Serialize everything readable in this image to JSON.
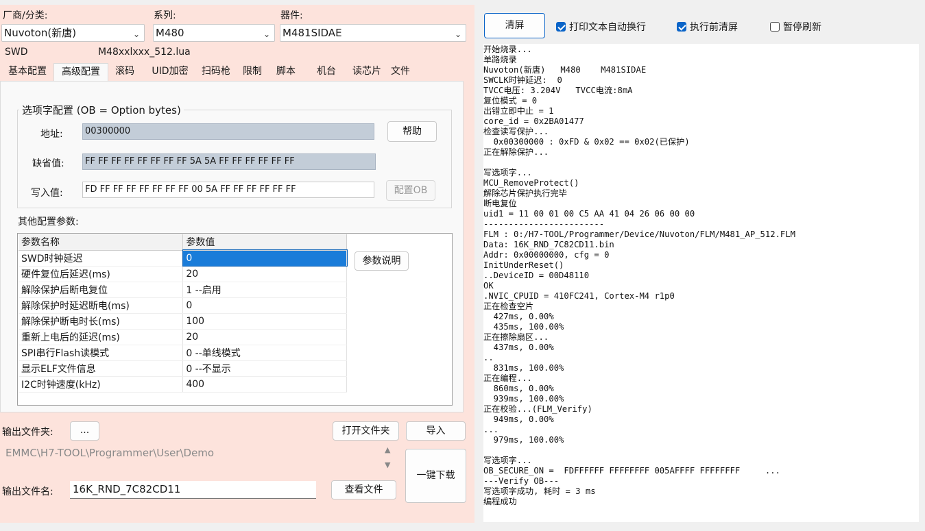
{
  "selectors": {
    "vendor_label": "厂商/分类:",
    "vendor_value": "Nuvoton(新唐)",
    "series_label": "系列:",
    "series_value": "M480",
    "device_label": "器件:",
    "device_value": "M481SIDAE"
  },
  "interface": "SWD",
  "lua_file": "M48xxlxxx_512.lua",
  "tabs": [
    {
      "label": "基本配置"
    },
    {
      "label": "高级配置"
    },
    {
      "label": "滚码"
    },
    {
      "label": "UID加密"
    },
    {
      "label": "扫码枪"
    },
    {
      "label": "限制"
    },
    {
      "label": "脚本"
    },
    {
      "label": "机台"
    },
    {
      "label": "读芯片"
    },
    {
      "label": "文件"
    }
  ],
  "option_bytes": {
    "legend": "选项字配置 (OB = Option bytes)",
    "address_label": "地址:",
    "address_value": "00300000",
    "default_label": "缺省值:",
    "default_value": "FF FF FF FF FF FF FF FF 5A 5A FF FF FF FF FF FF",
    "write_label": "写入值:",
    "write_value": "FD FF FF FF FF FF FF FF 00 5A FF FF FF FF FF FF",
    "help_button": "帮助",
    "config_button": "配置OB"
  },
  "other_params": {
    "title": "其他配置参数:",
    "col_name": "参数名称",
    "col_value": "参数值",
    "explain_button": "参数说明",
    "rows": [
      {
        "name": "SWD时钟延迟",
        "value": "0"
      },
      {
        "name": "硬件复位后延迟(ms)",
        "value": "20"
      },
      {
        "name": "解除保护后断电复位",
        "value": "1 --启用"
      },
      {
        "name": "解除保护时延迟断电(ms)",
        "value": "0"
      },
      {
        "name": "解除保护断电时长(ms)",
        "value": "100"
      },
      {
        "name": "重新上电后的延迟(ms)",
        "value": "20"
      },
      {
        "name": "SPI串行Flash读模式",
        "value": "0 --单线模式"
      },
      {
        "name": "显示ELF文件信息",
        "value": "0 --不显示"
      },
      {
        "name": "I2C时钟速度(kHz)",
        "value": "400"
      }
    ]
  },
  "output": {
    "folder_label": "输出文件夹:",
    "browse_button": "...",
    "open_folder_button": "打开文件夹",
    "import_button": "导入",
    "path_value": "EMMC\\H7-TOOL\\Programmer\\User\\Demo",
    "download_button": "一键下载",
    "filename_label": "输出文件名:",
    "filename_value": "16K_RND_7C82CD11",
    "view_file_button": "查看文件"
  },
  "right_toolbar": {
    "clear_button": "清屏",
    "auto_wrap": {
      "label": "打印文本自动换行",
      "checked": true
    },
    "clear_before": {
      "label": "执行前清屏",
      "checked": true
    },
    "pause_refresh": {
      "label": "暂停刷新",
      "checked": false
    }
  },
  "log_lines": [
    "开始烧录...",
    "单路烧录",
    "Nuvoton(新唐)   M480    M481SIDAE",
    "SWCLK时钟延迟:  0",
    "TVCC电压: 3.204V   TVCC电流:8mA",
    "复位模式 = 0",
    "出错立即中止 = 1",
    "core_id = 0x2BA01477",
    "检查读写保护...",
    "  0x00300000 : 0xFD & 0x02 == 0x02(已保护)",
    "正在解除保护...",
    "",
    "写选项字...",
    "MCU_RemoveProtect()",
    "解除芯片保护执行完毕",
    "断电复位",
    "uid1 = 11 00 01 00 C5 AA 41 04 26 06 00 00",
    "------------------------",
    "FLM : 0:/H7-TOOL/Programmer/Device/Nuvoton/FLM/M481_AP_512.FLM",
    "Data: 16K_RND_7C82CD11.bin",
    "Addr: 0x00000000, cfg = 0",
    "InitUnderReset()",
    "..DeviceID = 00D48110",
    "OK",
    ".NVIC_CPUID = 410FC241, Cortex-M4 r1p0",
    "正在检查空片",
    "  427ms, 0.00%",
    "  435ms, 100.00%",
    "正在擦除扇区...",
    "  437ms, 0.00%",
    "..",
    "  831ms, 100.00%",
    "正在编程...",
    "  860ms, 0.00%",
    "  939ms, 100.00%",
    "正在校验...(FLM_Verify)",
    "  949ms, 0.00%",
    "...",
    "  979ms, 100.00%",
    "",
    "写选项字...",
    "OB_SECURE_ON =  FDFFFFFF FFFFFFFF 005AFFFF FFFFFFFF     ...",
    "---Verify OB---",
    "写选项字成功, 耗时 = 3 ms",
    "编程成功"
  ]
}
